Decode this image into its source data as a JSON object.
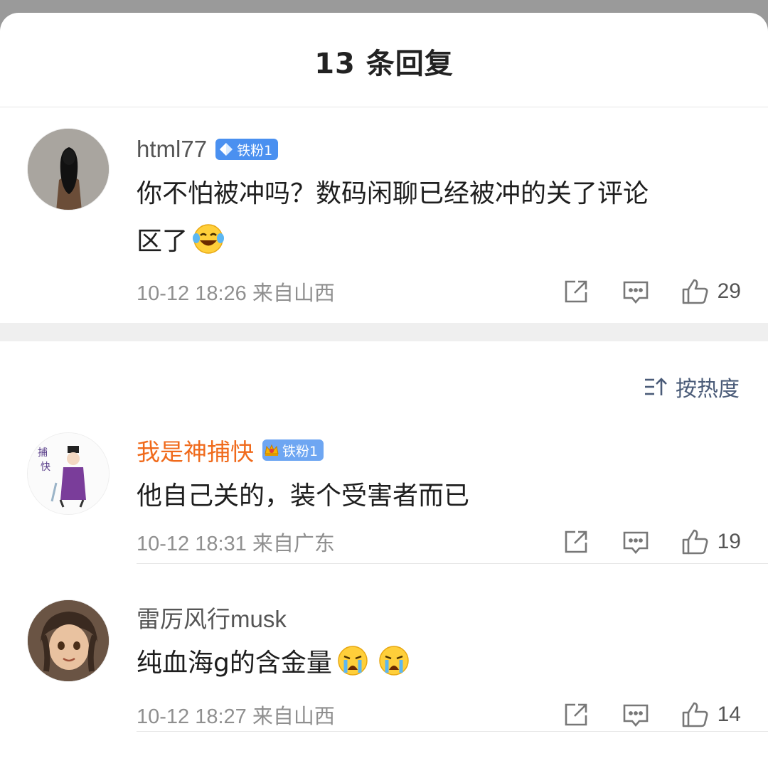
{
  "header": {
    "title": "13 条回复"
  },
  "root_comment": {
    "username": "html77",
    "badge": "铁粉1",
    "text_line1": "你不怕被冲吗？数码闲聊已经被冲的关了评论",
    "text_line2": "区了",
    "emoji": "laughing-tears-emoji",
    "meta": "10-12 18:26 来自山西",
    "likes": "29"
  },
  "sort": {
    "label": "按热度",
    "icon": "sort-icon"
  },
  "replies": [
    {
      "username": "我是神捕快",
      "badge": "铁粉1",
      "text": "他自己关的，装个受害者而已",
      "meta": "10-12 18:31 来自广东",
      "likes": "19",
      "name_color": "#f06a1b"
    },
    {
      "username": "雷厉风行musk",
      "text": "纯血海g的含金量",
      "emojis": [
        "crying-emoji",
        "crying-emoji"
      ],
      "meta": "10-12 18:27 来自山西",
      "likes": "14"
    }
  ],
  "colors": {
    "accent": "#4a90f0",
    "sort": "#4a5b78",
    "meta": "#8f8f8f",
    "gap": "#efefef"
  }
}
